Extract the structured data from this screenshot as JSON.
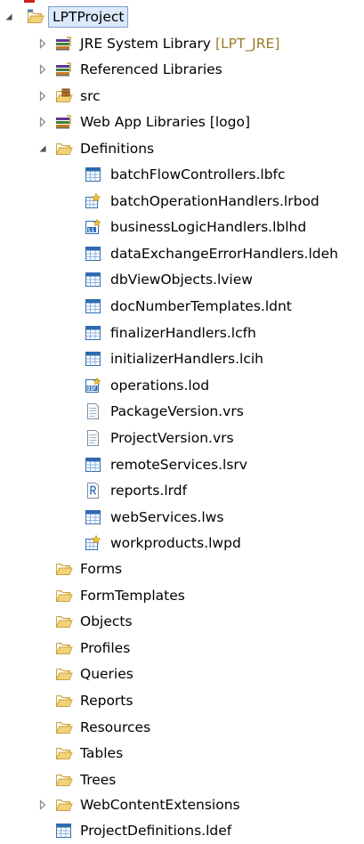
{
  "tree": {
    "root": {
      "label": "LPTProject",
      "expanded": true,
      "icon": "project-folder-icon"
    },
    "project_items": [
      {
        "label": "JRE System Library",
        "decoration": "[LPT_JRE]",
        "icon": "library-icon",
        "twisty": "collapsed"
      },
      {
        "label": "Referenced Libraries",
        "decoration": "",
        "icon": "library-icon",
        "twisty": "collapsed"
      },
      {
        "label": "src",
        "decoration": "",
        "icon": "package-folder-icon",
        "twisty": "collapsed"
      },
      {
        "label": "Web App Libraries [logo]",
        "decoration": "",
        "icon": "library-icon",
        "twisty": "collapsed"
      },
      {
        "label": "Definitions",
        "decoration": "",
        "icon": "folder-open-icon",
        "twisty": "expanded"
      }
    ],
    "definitions_children": [
      {
        "label": "batchFlowControllers.lbfc",
        "icon": "table-file-icon"
      },
      {
        "label": "batchOperationHandlers.lrbod",
        "icon": "handler-file-icon"
      },
      {
        "label": "businessLogicHandlers.lblhd",
        "icon": "bl-file-icon"
      },
      {
        "label": "dataExchangeErrorHandlers.ldeh",
        "icon": "table-file-icon"
      },
      {
        "label": "dbViewObjects.lview",
        "icon": "table-file-icon"
      },
      {
        "label": "docNumberTemplates.ldnt",
        "icon": "table-file-icon"
      },
      {
        "label": "finalizerHandlers.lcfh",
        "icon": "table-file-icon"
      },
      {
        "label": "initializerHandlers.lcih",
        "icon": "table-file-icon"
      },
      {
        "label": "operations.lod",
        "icon": "bo-file-icon"
      },
      {
        "label": "PackageVersion.vrs",
        "icon": "text-file-icon"
      },
      {
        "label": "ProjectVersion.vrs",
        "icon": "text-file-icon"
      },
      {
        "label": "remoteServices.lsrv",
        "icon": "table-file-icon"
      },
      {
        "label": "reports.lrdf",
        "icon": "report-file-icon"
      },
      {
        "label": "webServices.lws",
        "icon": "table-file-icon"
      },
      {
        "label": "workproducts.lwpd",
        "icon": "handler-file-icon"
      }
    ],
    "folders": [
      {
        "label": "Forms",
        "icon": "folder-open-icon"
      },
      {
        "label": "FormTemplates",
        "icon": "folder-open-icon"
      },
      {
        "label": "Objects",
        "icon": "folder-open-icon"
      },
      {
        "label": "Profiles",
        "icon": "folder-open-icon"
      },
      {
        "label": "Queries",
        "icon": "folder-open-icon"
      },
      {
        "label": "Reports",
        "icon": "folder-open-icon"
      },
      {
        "label": "Resources",
        "icon": "folder-open-icon"
      },
      {
        "label": "Tables",
        "icon": "folder-open-icon"
      },
      {
        "label": "Trees",
        "icon": "folder-open-icon"
      }
    ],
    "tail_items": [
      {
        "label": "WebContentExtensions",
        "icon": "folder-open-icon",
        "twisty": "collapsed"
      },
      {
        "label": "ProjectDefinitions.ldef",
        "icon": "table-file-icon",
        "twisty": "none"
      }
    ]
  },
  "colors": {
    "selection_fill": "#dbe9fa",
    "selection_border": "#7da2ce",
    "decoration_text": "#9a7a2a",
    "folder_fill": "#f3d27a",
    "folder_stroke": "#c9a140",
    "table_icon_blue": "#2f6bb0"
  }
}
